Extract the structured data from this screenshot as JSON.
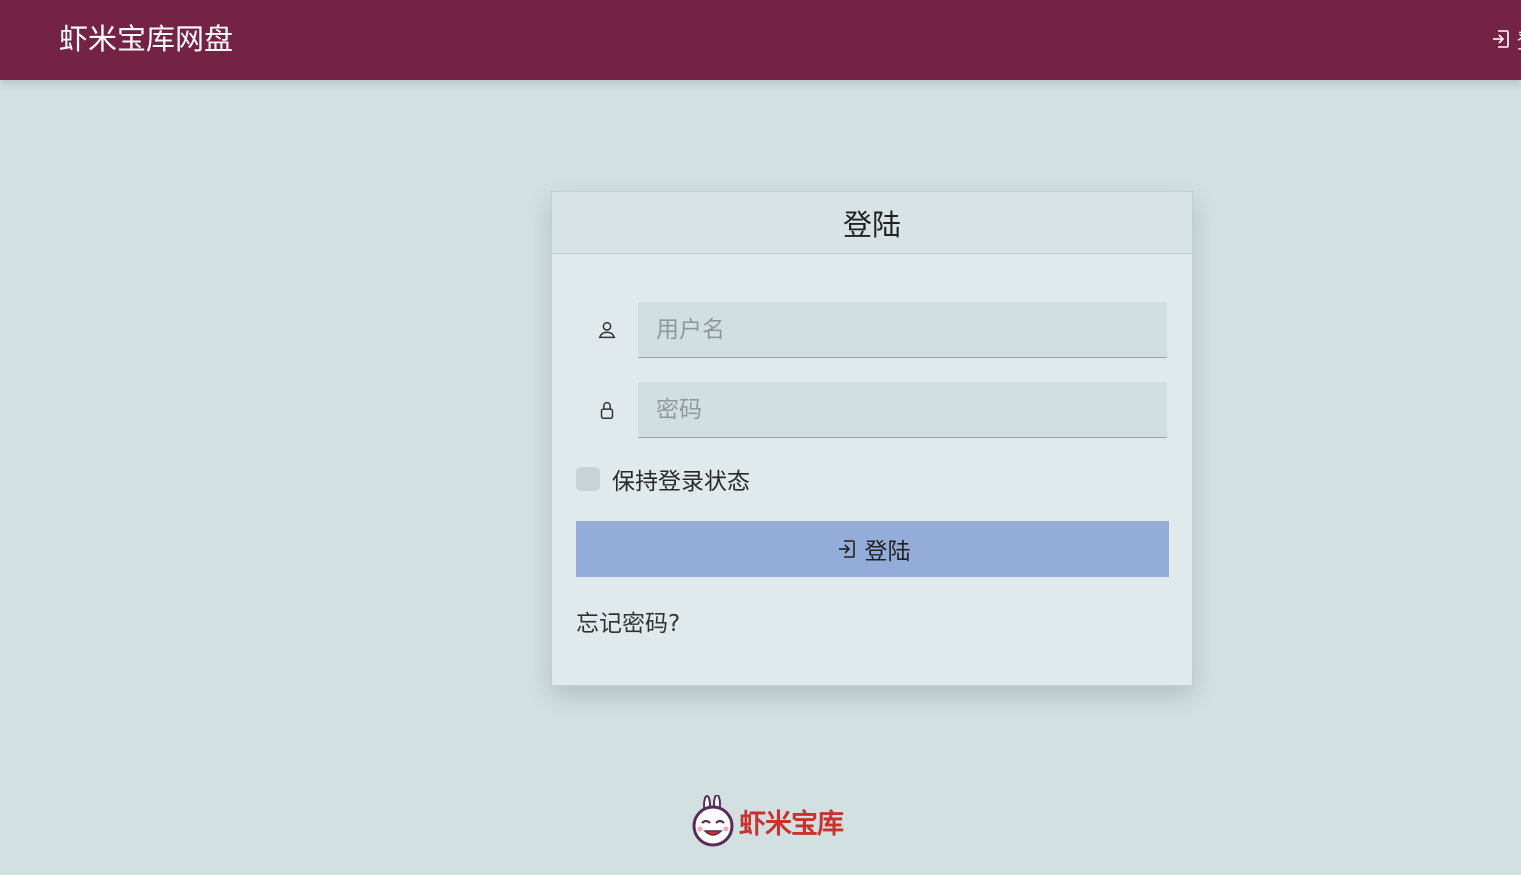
{
  "header": {
    "brand": "虾米宝库网盘",
    "login_label": "登"
  },
  "login_card": {
    "title": "登陆",
    "username": {
      "placeholder": "用户名",
      "value": ""
    },
    "password": {
      "placeholder": "密码",
      "value": ""
    },
    "remember_label": "保持登录状态",
    "remember_checked": false,
    "submit_label": "登陆",
    "forgot_label": "忘记密码?"
  },
  "footer": {
    "logo_text": "虾米宝库"
  },
  "colors": {
    "header_bg": "#752345",
    "page_bg": "#d2e0e2",
    "button_bg": "#93acd9",
    "logo_text": "#c8322f"
  },
  "icons": {
    "nav_login": "login-icon",
    "username": "user-icon",
    "password": "lock-icon",
    "submit": "login-icon",
    "logo": "rabbit-mascot-icon"
  }
}
